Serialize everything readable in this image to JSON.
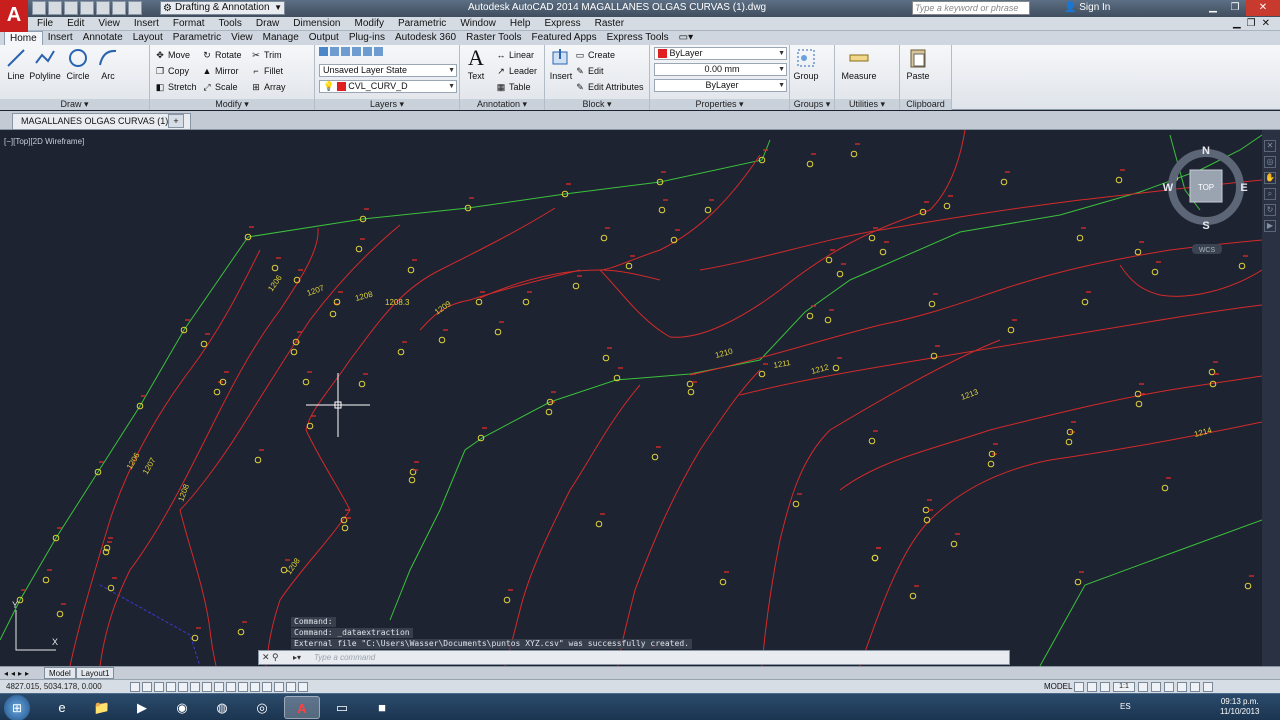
{
  "app": {
    "logo": "A",
    "title": "Autodesk AutoCAD 2014    MAGALLANES OLGAS CURVAS (1).dwg",
    "workspace": "Drafting & Annotation",
    "search_placeholder": "Type a keyword or phrase",
    "sign_in": "Sign In"
  },
  "menubar": [
    "File",
    "Edit",
    "View",
    "Insert",
    "Format",
    "Tools",
    "Draw",
    "Dimension",
    "Modify",
    "Parametric",
    "Window",
    "Help",
    "Express",
    "Raster"
  ],
  "ribbon_tabs": [
    "Home",
    "Insert",
    "Annotate",
    "Layout",
    "Parametric",
    "View",
    "Manage",
    "Output",
    "Plug-ins",
    "Autodesk 360",
    "Raster Tools",
    "Featured Apps",
    "Express Tools"
  ],
  "panels": {
    "draw": {
      "title": "Draw",
      "line": "Line",
      "polyline": "Polyline",
      "circle": "Circle",
      "arc": "Arc"
    },
    "modify": {
      "title": "Modify",
      "move": "Move",
      "rotate": "Rotate",
      "trim": "Trim",
      "copy": "Copy",
      "mirror": "Mirror",
      "fillet": "Fillet",
      "stretch": "Stretch",
      "scale": "Scale",
      "array": "Array"
    },
    "layers": {
      "title": "Layers",
      "layer_state": "Unsaved Layer State",
      "current_layer": "CVL_CURV_D"
    },
    "annotation": {
      "title": "Annotation",
      "text": "Text",
      "linear": "Linear",
      "leader": "Leader",
      "table": "Table"
    },
    "block": {
      "title": "Block",
      "insert": "Insert",
      "create": "Create",
      "edit": "Edit",
      "edit_attributes": "Edit Attributes"
    },
    "properties": {
      "title": "Properties",
      "color": "ByLayer",
      "lineweight": "0.00 mm",
      "linetype": "ByLayer"
    },
    "groups": {
      "title": "Groups",
      "group": "Group"
    },
    "utilities": {
      "title": "Utilities",
      "measure": "Measure"
    },
    "clipboard": {
      "title": "Clipboard",
      "paste": "Paste"
    }
  },
  "document_tab": "MAGALLANES OLGAS CURVAS (1)*",
  "viewport_label": "[−][Top][2D Wireframe]",
  "viewcube": {
    "top": "TOP",
    "north": "N",
    "south": "S",
    "east": "E",
    "west": "W",
    "wcs": "WCS"
  },
  "contour_labels": [
    "1206",
    "1207",
    "1208",
    "1208.3",
    "1209",
    "1210",
    "1211",
    "1212",
    "1213",
    "1214",
    "1206",
    "1207",
    "1208",
    "1208"
  ],
  "command_history": [
    "Command:",
    "Command: _dataextraction",
    "External file \"C:\\Users\\Wasser\\Documents\\puntos XYZ.csv\" was successfully created."
  ],
  "command_placeholder": "Type a command",
  "layout_tabs": [
    "Model",
    "Layout1"
  ],
  "status": {
    "coords": "4827.015, 5034.178, 0.000",
    "model": "MODEL",
    "scale": "1:1"
  },
  "taskbar": {
    "lang": "ES",
    "time": "09:13 p.m.",
    "date": "11/10/2013"
  },
  "colors": {
    "contour_red": "#d42a2a",
    "breakline_green": "#3cc13c",
    "point_yellow": "#e0d23a",
    "background": "#1d2331"
  }
}
